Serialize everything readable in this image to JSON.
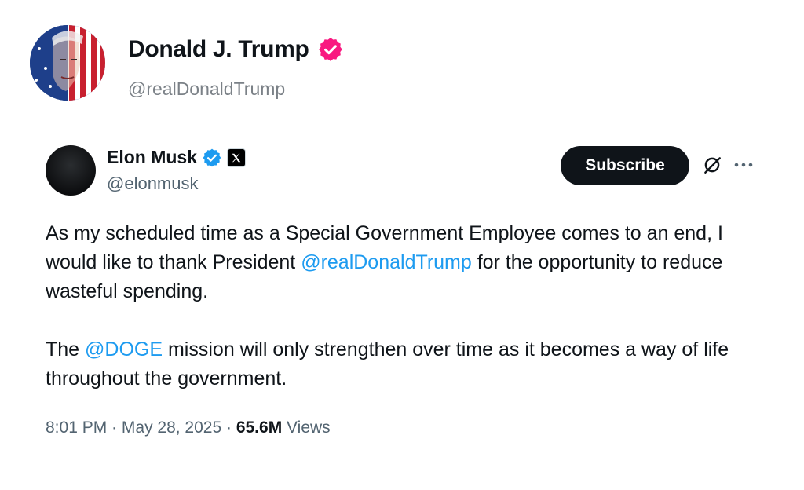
{
  "profile": {
    "name": "Donald J. Trump",
    "handle": "@realDonaldTrump",
    "verified_color": "#f91880"
  },
  "tweet": {
    "author_name": "Elon Musk",
    "author_handle": "@elonmusk",
    "verified_color": "#1d9bf0",
    "subscribe_label": "Subscribe",
    "paragraph1": {
      "before": "As my scheduled time as a Special Government Employee comes to an end, I would like to thank President ",
      "mention": "@realDonaldTrump",
      "after": " for the opportunity to reduce wasteful spending."
    },
    "paragraph2": {
      "before": "The ",
      "mention": "@DOGE",
      "after": " mission will only strengthen over time as it becomes a way of life throughout the government."
    },
    "time": "8:01 PM",
    "date": "May 28, 2025",
    "separator": " · ",
    "views_count": "65.6M",
    "views_label": " Views"
  },
  "icons": {
    "trump_verified": "verified-badge-icon",
    "musk_verified": "verified-check-icon",
    "affiliate": "x-logo-icon",
    "grok": "grok-icon",
    "more": "more-icon"
  }
}
